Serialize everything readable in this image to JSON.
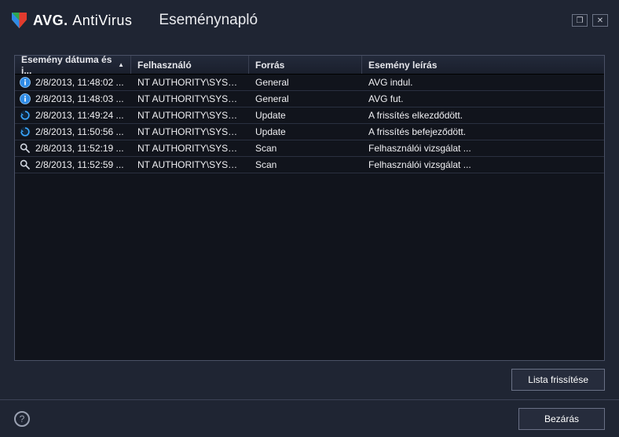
{
  "brand": {
    "name": "AVG",
    "product": "AntiVirus"
  },
  "page_title": "Eseménynapló",
  "window_controls": {
    "maximize": "❐",
    "close": "✕"
  },
  "columns": {
    "date": "Esemény dátuma és i...",
    "user": "Felhasználó",
    "source": "Forrás",
    "desc": "Esemény leírás"
  },
  "rows": [
    {
      "icon": "info",
      "date": "2/8/2013, 11:48:02 ...",
      "user": "NT AUTHORITY\\SYSTEM",
      "source": "General",
      "desc": "AVG indul."
    },
    {
      "icon": "info",
      "date": "2/8/2013, 11:48:03 ...",
      "user": "NT AUTHORITY\\SYSTEM",
      "source": "General",
      "desc": "AVG fut."
    },
    {
      "icon": "update",
      "date": "2/8/2013, 11:49:24 ...",
      "user": "NT AUTHORITY\\SYSTEM",
      "source": "Update",
      "desc": "A frissítés elkezdődött."
    },
    {
      "icon": "update",
      "date": "2/8/2013, 11:50:56 ...",
      "user": "NT AUTHORITY\\SYSTEM",
      "source": "Update",
      "desc": "A frissítés befejeződött."
    },
    {
      "icon": "scan",
      "date": "2/8/2013, 11:52:19 ...",
      "user": "NT AUTHORITY\\SYSTEM",
      "source": "Scan",
      "desc": "Felhasználói vizsgálat ..."
    },
    {
      "icon": "scan",
      "date": "2/8/2013, 11:52:59 ...",
      "user": "NT AUTHORITY\\SYSTEM",
      "source": "Scan",
      "desc": "Felhasználói vizsgálat ..."
    }
  ],
  "buttons": {
    "refresh": "Lista frissítése",
    "close": "Bezárás"
  }
}
